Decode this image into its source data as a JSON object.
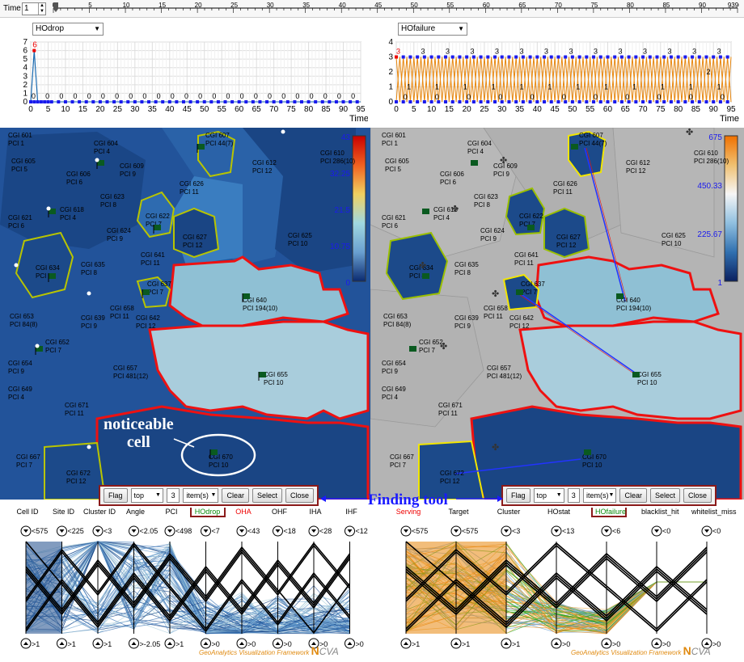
{
  "timebar": {
    "label": "Time",
    "value": "1",
    "ticks": [
      "0",
      "5",
      "10",
      "15",
      "20",
      "25",
      "30",
      "35",
      "40",
      "45",
      "50",
      "55",
      "60",
      "65",
      "70",
      "75",
      "80",
      "85",
      "90",
      "9396"
    ]
  },
  "left_chart": {
    "metric": "HOdrop",
    "ylabels": [
      "7",
      "6",
      "5",
      "4",
      "3",
      "2",
      "1",
      "0"
    ],
    "xlabels": [
      "0",
      "5",
      "10",
      "15",
      "20",
      "25",
      "30",
      "35",
      "40",
      "45",
      "50",
      "55",
      "60",
      "65",
      "70",
      "75",
      "80",
      "85",
      "90",
      "95"
    ],
    "xtitle": "Time",
    "peak_label": "6",
    "zero_label": "0"
  },
  "right_chart": {
    "metric": "HOfailure",
    "ylabels": [
      "4",
      "3",
      "2",
      "1",
      "0"
    ],
    "xlabels": [
      "0",
      "5",
      "10",
      "15",
      "20",
      "25",
      "30",
      "35",
      "40",
      "45",
      "50",
      "55",
      "60",
      "65",
      "70",
      "75",
      "80",
      "85",
      "90",
      "95"
    ],
    "xtitle": "Time",
    "labels3": "3",
    "labels1": "1",
    "labels0": "0",
    "labels2": "2"
  },
  "left_map": {
    "legend": [
      "43",
      "32.25",
      "21.5",
      "10.75",
      "0"
    ],
    "cells": [
      [
        "CGI 601",
        "PCI 1"
      ],
      [
        "CGI 604",
        "PCI 4"
      ],
      [
        "CGI 607",
        "PCI 44(7)"
      ],
      [
        "CGI 612",
        "PCI 12"
      ],
      [
        "CGI 610",
        "PCI 286(10)"
      ],
      [
        "CGI 605",
        "PCI 5"
      ],
      [
        "CGI 606",
        "PCI 6"
      ],
      [
        "CGI 609",
        "PCI 9"
      ],
      [
        "CGI 623",
        "PCI 8"
      ],
      [
        "CGI 626",
        "PCI 11"
      ],
      [
        "CGI 618",
        "PCI 4"
      ],
      [
        "CGI 622",
        "PCI 7"
      ],
      [
        "CGI 621",
        "PCI 6"
      ],
      [
        "CGI 624",
        "PCI 9"
      ],
      [
        "CGI 627",
        "PCI 12"
      ],
      [
        "CGI 625",
        "PCI 10"
      ],
      [
        "CGI 634",
        "PCI 4"
      ],
      [
        "CGI 635",
        "PCI 8"
      ],
      [
        "CGI 641",
        "PCI 11"
      ],
      [
        "CGI 637",
        "PCI 7"
      ],
      [
        "CGI 640",
        "PCI 194(10)"
      ],
      [
        "CGI 653",
        "PCI 84(8)"
      ],
      [
        "CGI 658",
        "PCI 11"
      ],
      [
        "CGI 639",
        "PCI 9"
      ],
      [
        "CGI 642",
        "PCI 12"
      ],
      [
        "CGI 652",
        "PCI 7"
      ],
      [
        "CGI 654",
        "PCI 9"
      ],
      [
        "CGI 657",
        "PCI 481(12)"
      ],
      [
        "CGI 655",
        "PCI 10"
      ],
      [
        "CGI 649",
        "PCI 4"
      ],
      [
        "CGI 671",
        "PCI 11"
      ],
      [
        "CGI 667",
        "PCI 7"
      ],
      [
        "CGI 672",
        "PCI 12"
      ],
      [
        "CGI 670",
        "PCI 10"
      ]
    ]
  },
  "right_map": {
    "legend": [
      "675",
      "450.33",
      "225.67",
      "1"
    ]
  },
  "annotation": {
    "line1": "noticeable",
    "line2": "cell"
  },
  "finder_left": {
    "flag": "Flag",
    "mode": "top",
    "count": "3",
    "unit": "item(s)",
    "clear": "Clear",
    "select": "Select",
    "close": "Close"
  },
  "finder_right": {
    "flag": "Flag",
    "mode": "top",
    "count": "3",
    "unit": "item(s)",
    "clear": "Clear",
    "select": "Select",
    "close": "Close"
  },
  "finding_tool": "Finding tool",
  "left_axes": [
    "Cell ID",
    "Site ID",
    "Cluster ID",
    "Angle",
    "PCI",
    "HOdrop",
    "OHA",
    "OHF",
    "IHA",
    "IHF"
  ],
  "left_top_vals": [
    "<575",
    "<225",
    "<3",
    "<2.05",
    "<498",
    "<7",
    "<43",
    "<18",
    "<28",
    "<12"
  ],
  "left_bot_vals": [
    ">1",
    ">1",
    ">1",
    ">-2.05",
    ">1",
    ">0",
    ">0",
    ">0",
    ">0",
    ">0"
  ],
  "right_axes": [
    "Serving",
    "Target",
    "Cluster",
    "HOstat",
    "HOfailure",
    "blacklist_hit",
    "whitelist_miss"
  ],
  "right_top_vals": [
    "<575",
    "<575",
    "<3",
    "<13",
    "<6",
    "<0",
    "<0"
  ],
  "right_bot_vals": [
    ">1",
    ">1",
    ">1",
    ">0",
    ">0",
    ">0",
    ">0"
  ],
  "brand": {
    "text": "GeoAnalytics Visualization Framework",
    "logo_n": "N",
    "logo_cva": "CVA"
  },
  "colors": {
    "map_dark": "#1c4a8a",
    "map_mid": "#2e6bb0",
    "map_light": "#a9cddc",
    "map_gray": "#b4b4b4",
    "red": "#ee1111",
    "yellow": "#d8e000",
    "orange": "#e8860c"
  }
}
